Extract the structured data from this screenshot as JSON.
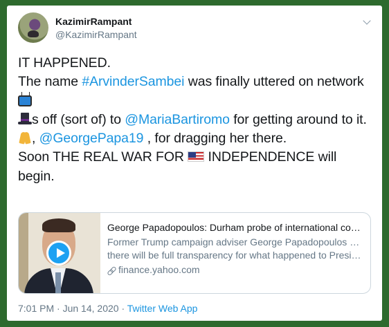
{
  "user": {
    "display_name": "KazimirRampant",
    "handle": "@KazimirRampant"
  },
  "tweet": {
    "line1": "IT HAPPENED.",
    "line2_pre": "The name ",
    "line2_hashtag": "#ArvinderSambei",
    "line2_post": " was finally uttered on network",
    "line3_pre": "s off (sort of) to ",
    "line3_mention": "@MariaBartiromo",
    "line3_post": " for getting around to it.",
    "line4_pre": ", ",
    "line4_mention": "@GeorgePapa19",
    "line4_post": " , for dragging her there.",
    "line5_pre": "Soon THE REAL WAR FOR ",
    "line5_post": " INDEPENDENCE will begin."
  },
  "icons": {
    "tv": "television-emoji",
    "hat": "top-hat-emoji",
    "hands": "folded-hands-emoji",
    "flag": "us-flag-emoji",
    "more": "chevron-down-icon",
    "play": "play-icon",
    "link": "link-icon"
  },
  "preview": {
    "title": "George Papadopoulos: Durham probe of international conduc...",
    "desc_line1": "Former Trump campaign adviser George Papadopoulos says",
    "desc_line2": "there will be full transparency for what happened to President...",
    "domain": "finance.yahoo.com"
  },
  "meta": {
    "time": "7:01 PM",
    "sep1": " · ",
    "date": "Jun 14, 2020",
    "sep2": " · ",
    "source": "Twitter Web App"
  },
  "colors": {
    "link": "#1b95e0",
    "border_bg": "#2e6a2e",
    "play_button": "#1da1f2"
  }
}
